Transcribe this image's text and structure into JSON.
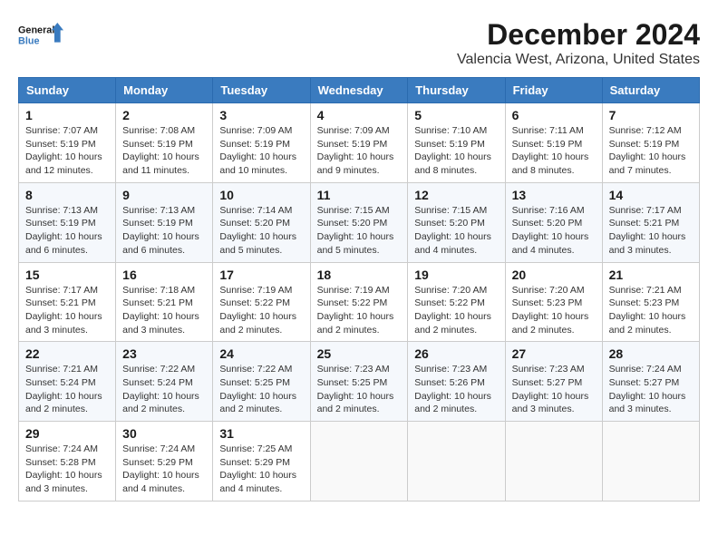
{
  "logo": {
    "text_general": "General",
    "text_blue": "Blue"
  },
  "title": "December 2024",
  "subtitle": "Valencia West, Arizona, United States",
  "days_of_week": [
    "Sunday",
    "Monday",
    "Tuesday",
    "Wednesday",
    "Thursday",
    "Friday",
    "Saturday"
  ],
  "weeks": [
    [
      {
        "day": "1",
        "sunrise": "Sunrise: 7:07 AM",
        "sunset": "Sunset: 5:19 PM",
        "daylight": "Daylight: 10 hours and 12 minutes."
      },
      {
        "day": "2",
        "sunrise": "Sunrise: 7:08 AM",
        "sunset": "Sunset: 5:19 PM",
        "daylight": "Daylight: 10 hours and 11 minutes."
      },
      {
        "day": "3",
        "sunrise": "Sunrise: 7:09 AM",
        "sunset": "Sunset: 5:19 PM",
        "daylight": "Daylight: 10 hours and 10 minutes."
      },
      {
        "day": "4",
        "sunrise": "Sunrise: 7:09 AM",
        "sunset": "Sunset: 5:19 PM",
        "daylight": "Daylight: 10 hours and 9 minutes."
      },
      {
        "day": "5",
        "sunrise": "Sunrise: 7:10 AM",
        "sunset": "Sunset: 5:19 PM",
        "daylight": "Daylight: 10 hours and 8 minutes."
      },
      {
        "day": "6",
        "sunrise": "Sunrise: 7:11 AM",
        "sunset": "Sunset: 5:19 PM",
        "daylight": "Daylight: 10 hours and 8 minutes."
      },
      {
        "day": "7",
        "sunrise": "Sunrise: 7:12 AM",
        "sunset": "Sunset: 5:19 PM",
        "daylight": "Daylight: 10 hours and 7 minutes."
      }
    ],
    [
      {
        "day": "8",
        "sunrise": "Sunrise: 7:13 AM",
        "sunset": "Sunset: 5:19 PM",
        "daylight": "Daylight: 10 hours and 6 minutes."
      },
      {
        "day": "9",
        "sunrise": "Sunrise: 7:13 AM",
        "sunset": "Sunset: 5:19 PM",
        "daylight": "Daylight: 10 hours and 6 minutes."
      },
      {
        "day": "10",
        "sunrise": "Sunrise: 7:14 AM",
        "sunset": "Sunset: 5:20 PM",
        "daylight": "Daylight: 10 hours and 5 minutes."
      },
      {
        "day": "11",
        "sunrise": "Sunrise: 7:15 AM",
        "sunset": "Sunset: 5:20 PM",
        "daylight": "Daylight: 10 hours and 5 minutes."
      },
      {
        "day": "12",
        "sunrise": "Sunrise: 7:15 AM",
        "sunset": "Sunset: 5:20 PM",
        "daylight": "Daylight: 10 hours and 4 minutes."
      },
      {
        "day": "13",
        "sunrise": "Sunrise: 7:16 AM",
        "sunset": "Sunset: 5:20 PM",
        "daylight": "Daylight: 10 hours and 4 minutes."
      },
      {
        "day": "14",
        "sunrise": "Sunrise: 7:17 AM",
        "sunset": "Sunset: 5:21 PM",
        "daylight": "Daylight: 10 hours and 3 minutes."
      }
    ],
    [
      {
        "day": "15",
        "sunrise": "Sunrise: 7:17 AM",
        "sunset": "Sunset: 5:21 PM",
        "daylight": "Daylight: 10 hours and 3 minutes."
      },
      {
        "day": "16",
        "sunrise": "Sunrise: 7:18 AM",
        "sunset": "Sunset: 5:21 PM",
        "daylight": "Daylight: 10 hours and 3 minutes."
      },
      {
        "day": "17",
        "sunrise": "Sunrise: 7:19 AM",
        "sunset": "Sunset: 5:22 PM",
        "daylight": "Daylight: 10 hours and 2 minutes."
      },
      {
        "day": "18",
        "sunrise": "Sunrise: 7:19 AM",
        "sunset": "Sunset: 5:22 PM",
        "daylight": "Daylight: 10 hours and 2 minutes."
      },
      {
        "day": "19",
        "sunrise": "Sunrise: 7:20 AM",
        "sunset": "Sunset: 5:22 PM",
        "daylight": "Daylight: 10 hours and 2 minutes."
      },
      {
        "day": "20",
        "sunrise": "Sunrise: 7:20 AM",
        "sunset": "Sunset: 5:23 PM",
        "daylight": "Daylight: 10 hours and 2 minutes."
      },
      {
        "day": "21",
        "sunrise": "Sunrise: 7:21 AM",
        "sunset": "Sunset: 5:23 PM",
        "daylight": "Daylight: 10 hours and 2 minutes."
      }
    ],
    [
      {
        "day": "22",
        "sunrise": "Sunrise: 7:21 AM",
        "sunset": "Sunset: 5:24 PM",
        "daylight": "Daylight: 10 hours and 2 minutes."
      },
      {
        "day": "23",
        "sunrise": "Sunrise: 7:22 AM",
        "sunset": "Sunset: 5:24 PM",
        "daylight": "Daylight: 10 hours and 2 minutes."
      },
      {
        "day": "24",
        "sunrise": "Sunrise: 7:22 AM",
        "sunset": "Sunset: 5:25 PM",
        "daylight": "Daylight: 10 hours and 2 minutes."
      },
      {
        "day": "25",
        "sunrise": "Sunrise: 7:23 AM",
        "sunset": "Sunset: 5:25 PM",
        "daylight": "Daylight: 10 hours and 2 minutes."
      },
      {
        "day": "26",
        "sunrise": "Sunrise: 7:23 AM",
        "sunset": "Sunset: 5:26 PM",
        "daylight": "Daylight: 10 hours and 2 minutes."
      },
      {
        "day": "27",
        "sunrise": "Sunrise: 7:23 AM",
        "sunset": "Sunset: 5:27 PM",
        "daylight": "Daylight: 10 hours and 3 minutes."
      },
      {
        "day": "28",
        "sunrise": "Sunrise: 7:24 AM",
        "sunset": "Sunset: 5:27 PM",
        "daylight": "Daylight: 10 hours and 3 minutes."
      }
    ],
    [
      {
        "day": "29",
        "sunrise": "Sunrise: 7:24 AM",
        "sunset": "Sunset: 5:28 PM",
        "daylight": "Daylight: 10 hours and 3 minutes."
      },
      {
        "day": "30",
        "sunrise": "Sunrise: 7:24 AM",
        "sunset": "Sunset: 5:29 PM",
        "daylight": "Daylight: 10 hours and 4 minutes."
      },
      {
        "day": "31",
        "sunrise": "Sunrise: 7:25 AM",
        "sunset": "Sunset: 5:29 PM",
        "daylight": "Daylight: 10 hours and 4 minutes."
      },
      null,
      null,
      null,
      null
    ]
  ]
}
